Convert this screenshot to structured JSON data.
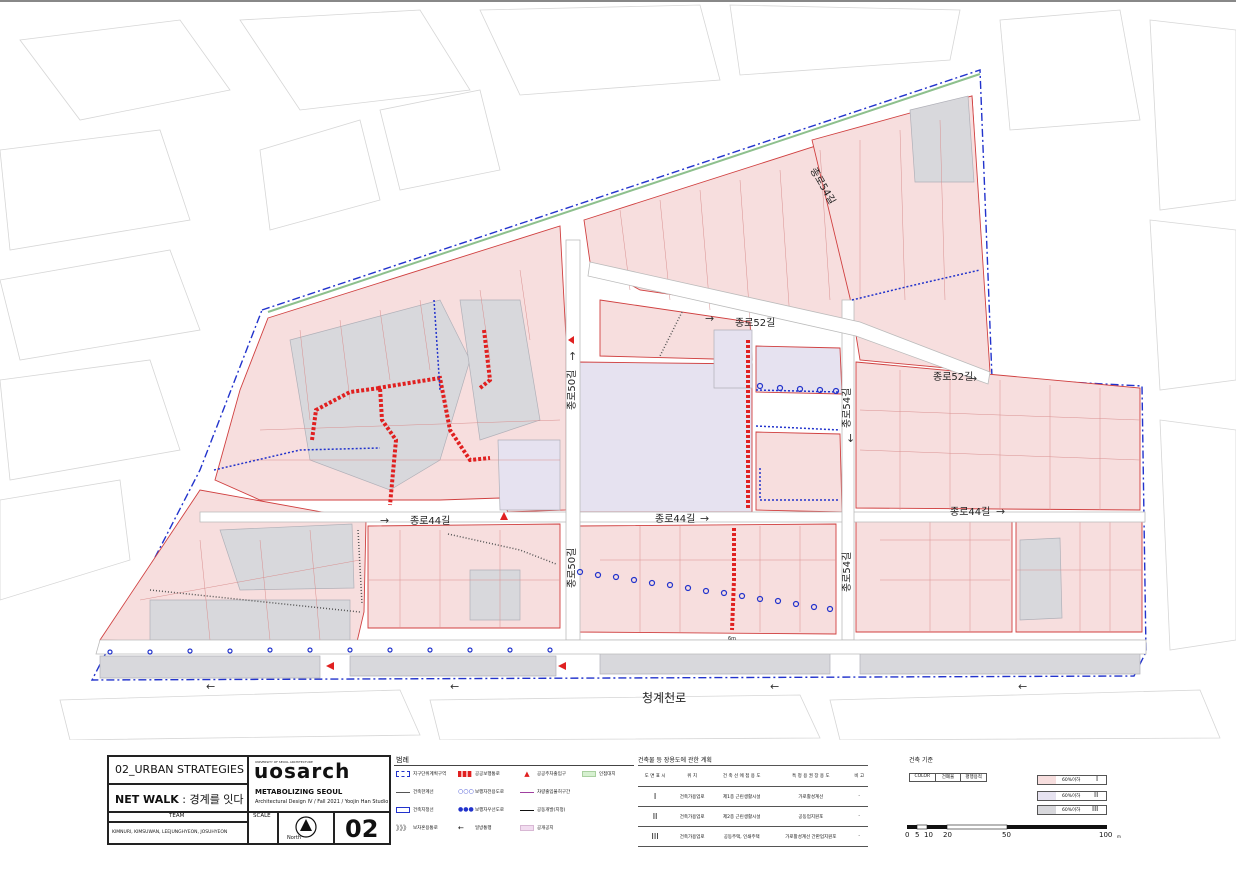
{
  "map": {
    "street_labels": {
      "jongno52_north": "종로52길",
      "jongno52_east": "종로52길",
      "jongno54_north": "종로54길",
      "jongno54_south": "종로54길",
      "jongno50_north": "종로50길",
      "jongno50_south": "종로50길",
      "jongno44_west": "종로44길",
      "jongno44_mid": "종로44길",
      "jongno44_east": "종로44길",
      "cheonggyecheon": "청계천로",
      "small_label": "6m"
    }
  },
  "title_block": {
    "section": "02_URBAN STRATEGIES",
    "project_bold": "NET WALK",
    "project_sep": " : ",
    "project_korean": "경계를 잇다",
    "team_label": "TEAM",
    "team_members": "KIMNURI, KIMSUWAN, LEEJUNGHYEON, JOSUHYEON",
    "scale_label": "SCALE",
    "north_label": "North",
    "logo_small": "UNIVERSITY OF SEOUL ARCHITECTURE",
    "logo": "uosarch",
    "course_title": "METABOLIZING SEOUL",
    "course_sub": "Architectural Design IV / Fall 2021 / Yoojin Han Studio",
    "sheet_number": "02"
  },
  "legend": {
    "title": "범례",
    "items": [
      {
        "label": "지구단위계획구역"
      },
      {
        "label": "공공보행통로"
      },
      {
        "label": "공공주차출입구"
      },
      {
        "label": "인접대지"
      },
      {
        "label": "건축한계선"
      },
      {
        "label": "보행자전용도로"
      },
      {
        "label": "차량출입불허구간"
      },
      {
        "label": "건축지정선"
      },
      {
        "label": "보행자우선도로"
      },
      {
        "label": "공동개발(지정)"
      },
      {
        "label": "보차혼용통로"
      },
      {
        "label": "일방통행"
      },
      {
        "label": "공개공지"
      }
    ]
  },
  "plan_table": {
    "title": "건축물 등 장용도에 관한 계획",
    "headers": [
      "도 면\n표 시",
      "위 치",
      "건 축 선 에\n접 용 도",
      "특 정 용\n권 장 용 도",
      "비 고"
    ],
    "rows": [
      [
        "I",
        "건축가용업로",
        "제1종 근린생활시설",
        "가로활성계선",
        "-"
      ],
      [
        "II",
        "건축가용업로",
        "제2종 근린생활시설",
        "공동업지원포",
        "-"
      ],
      [
        "III",
        "건축가용업로",
        "공동주택, 인쇄주택",
        "가로활성계선\n간판업지원포",
        "-"
      ]
    ]
  },
  "criteria": {
    "title": "건축 기준",
    "header_cells": [
      "COLOR",
      "건폐율",
      "평행용적"
    ],
    "rows": [
      {
        "value": "60%이하",
        "mark": "I",
        "color": "#f7dede"
      },
      {
        "value": "60%이하",
        "mark": "II",
        "color": "#e6e2f0"
      },
      {
        "value": "60%이하",
        "mark": "III",
        "color": "#d8d8dc"
      }
    ],
    "scale_ticks": [
      "0",
      "5",
      "10",
      "20",
      "50",
      "100"
    ],
    "scale_unit": "m"
  },
  "colors": {
    "parcel_pink": "#f7dede",
    "parcel_lavender": "#e6e2f0",
    "parcel_gray": "#d8d8dc",
    "boundary_blue": "#2233cc",
    "pedestrian_red": "#e02020",
    "parcel_outline": "#d04040"
  }
}
